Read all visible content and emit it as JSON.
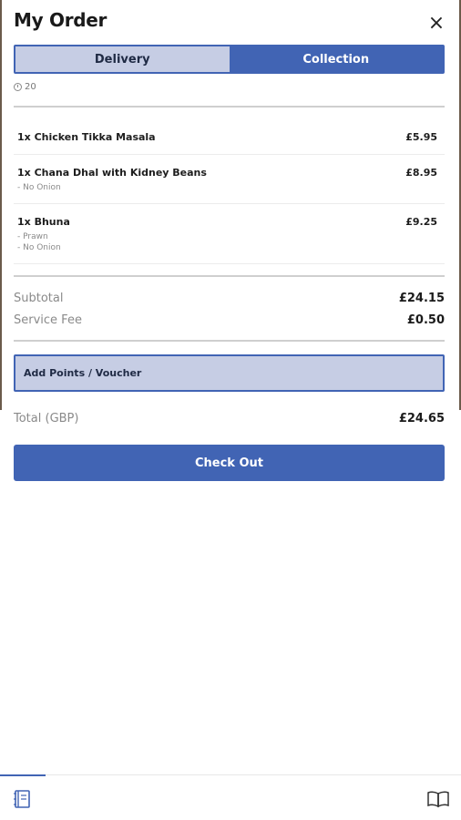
{
  "header": {
    "title": "My Order"
  },
  "mode_toggle": {
    "delivery_label": "Delivery",
    "collection_label": "Collection",
    "selected": "Collection"
  },
  "eta": {
    "minutes": "20"
  },
  "items": [
    {
      "qty_name": "1x Chicken Tikka Masala",
      "price": "£5.95",
      "modifiers": []
    },
    {
      "qty_name": "1x Chana Dhal with Kidney Beans",
      "price": "£8.95",
      "modifiers": [
        "- No Onion"
      ]
    },
    {
      "qty_name": "1x Bhuna",
      "price": "£9.25",
      "modifiers": [
        "- Prawn",
        "- No Onion"
      ]
    }
  ],
  "summary": {
    "subtotal_label": "Subtotal",
    "subtotal_value": "£24.15",
    "service_fee_label": "Service Fee",
    "service_fee_value": "£0.50",
    "total_label": "Total (GBP)",
    "total_value": "£24.65"
  },
  "voucher": {
    "label": "Add Points / Voucher"
  },
  "checkout": {
    "label": "Check Out"
  },
  "bottom_nav": {
    "left_icon": "menu-book-icon",
    "right_icon": "open-book-icon"
  },
  "colors": {
    "accent": "#4164b4",
    "accent_light": "#c6cde4"
  }
}
